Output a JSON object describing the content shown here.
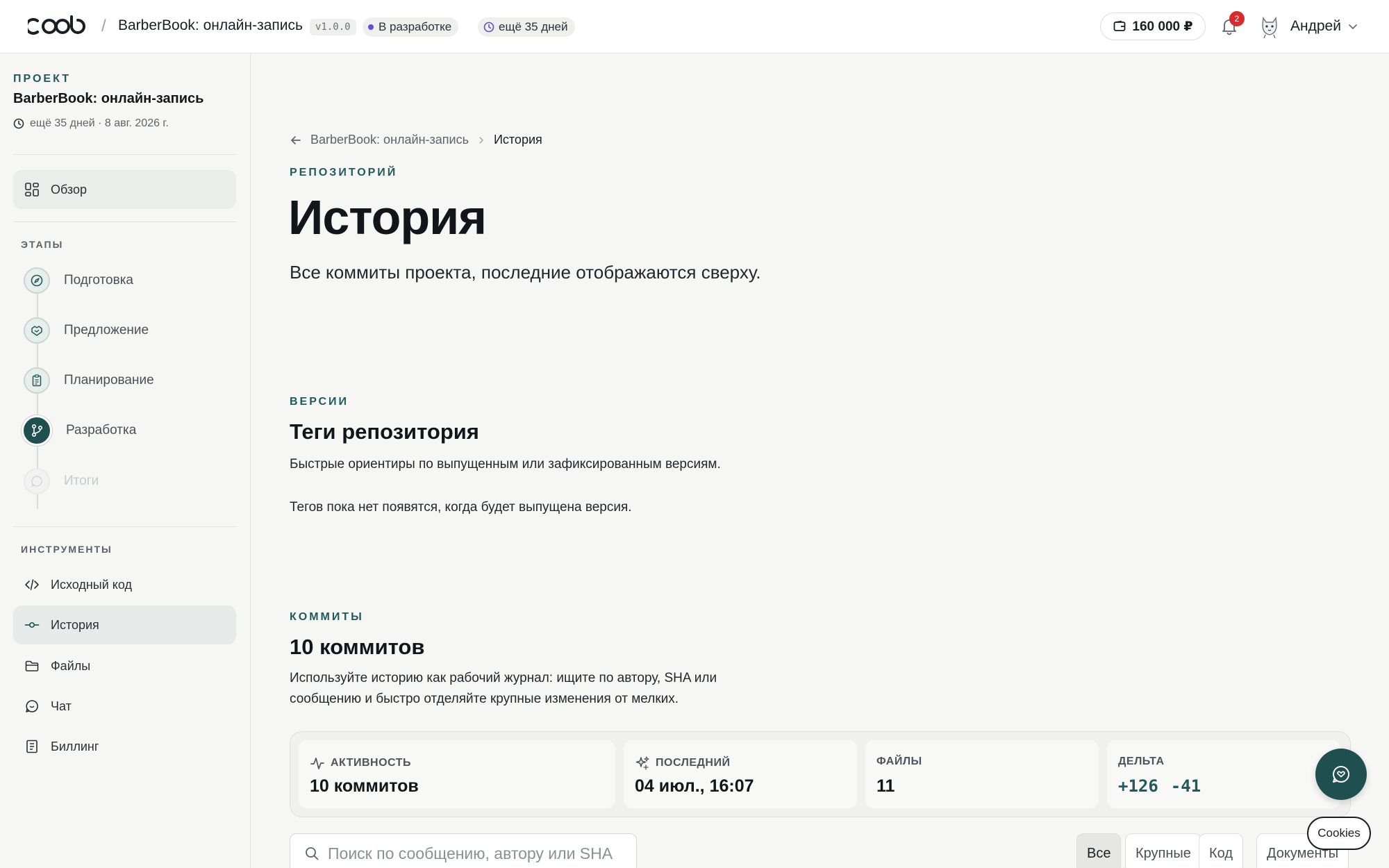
{
  "topbar": {
    "logo_text": "coob",
    "separator": "/",
    "project_title": "BarberBook: онлайн-запись",
    "version": "v1.0.0",
    "status": "В разработке",
    "days_left": "ещё 35 дней",
    "balance": "160 000 ₽",
    "notifications_count": "2",
    "user_name": "Андрей"
  },
  "sidebar": {
    "kicker": "ПРОЕКТ",
    "project_name": "BarberBook: онлайн-запись",
    "meta": "ещё 35 дней · 8 авг. 2026 г.",
    "overview_label": "Обзор",
    "stages_title": "ЭТАПЫ",
    "stages": [
      {
        "label": "Подготовка",
        "icon": "compass-icon"
      },
      {
        "label": "Предложение",
        "icon": "handshake-icon"
      },
      {
        "label": "Планирование",
        "icon": "clipboard-icon"
      },
      {
        "label": "Разработка",
        "icon": "git-branch-icon"
      },
      {
        "label": "Итоги",
        "icon": "chat-icon"
      }
    ],
    "tools_title": "ИНСТРУМЕНТЫ",
    "tools": [
      {
        "label": "Исходный код",
        "icon": "code-icon"
      },
      {
        "label": "История",
        "icon": "commit-icon"
      },
      {
        "label": "Файлы",
        "icon": "folder-icon"
      },
      {
        "label": "Чат",
        "icon": "chat-icon"
      },
      {
        "label": "Биллинг",
        "icon": "receipt-icon"
      }
    ]
  },
  "main": {
    "breadcrumb_parent": "BarberBook: онлайн-запись",
    "breadcrumb_current": "История",
    "kicker": "РЕПОЗИТОРИЙ",
    "title": "История",
    "lead": "Все коммиты проекта, последние отображаются сверху.",
    "tags": {
      "kicker": "ВЕРСИИ",
      "title": "Теги репозитория",
      "description": "Быстрые ориентиры по выпущенным или зафиксированным версиям.",
      "empty": "Тегов пока нет появятся, когда будет выпущена версия."
    },
    "commits": {
      "kicker": "КОММИТЫ",
      "title": "10 коммитов",
      "description": "Используйте историю как рабочий журнал: ищите по автору, SHA или сообщению и быстро отделяйте крупные изменения от мелких."
    },
    "stats": [
      {
        "label": "АКТИВНОСТЬ",
        "value": "10 коммитов",
        "icon": "activity-icon"
      },
      {
        "label": "ПОСЛЕДНИЙ",
        "value": "04 июл., 16:07",
        "icon": "sparkle-icon"
      },
      {
        "label": "ФАЙЛЫ",
        "value": "11"
      },
      {
        "label": "ДЕЛЬТА",
        "plus": "+126",
        "minus": "-41"
      }
    ],
    "search_placeholder": "Поиск по сообщению, автору или SHA",
    "filters": [
      "Все",
      "Крупные",
      "Код",
      "Документы"
    ]
  },
  "floating": {
    "cookies_label": "Cookies"
  },
  "colors": {
    "accent": "#22595a",
    "accent_dark": "#1f4f4f",
    "status_dot": "#5b50d6",
    "badge_red": "#d92b2b"
  }
}
